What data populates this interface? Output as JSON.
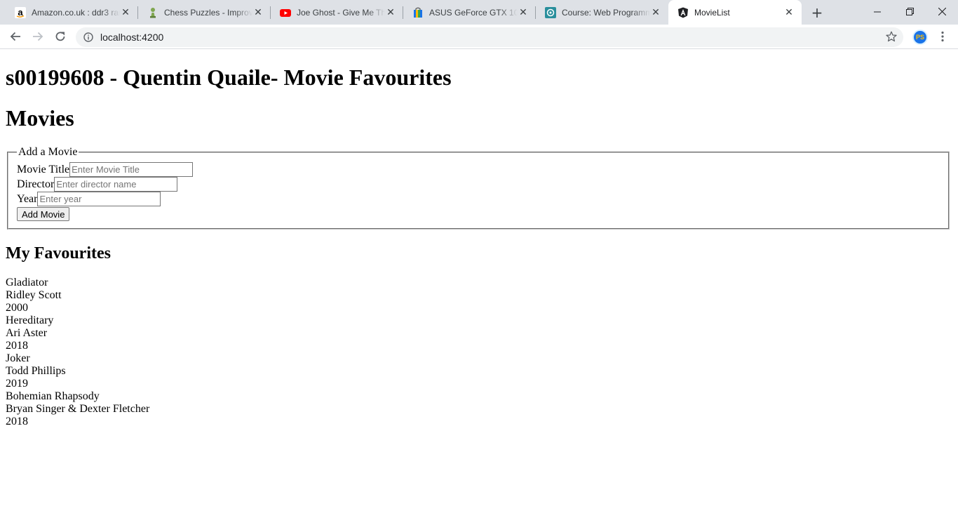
{
  "browser": {
    "tabs": [
      {
        "title": "Amazon.co.uk : ddr3 ram",
        "icon": "amazon-icon",
        "color": "#000000"
      },
      {
        "title": "Chess Puzzles - Improve",
        "icon": "chess-pawn-icon",
        "color": "#7fa650"
      },
      {
        "title": "Joe Ghost - Give Me That",
        "icon": "youtube-icon",
        "color": "#ff0000"
      },
      {
        "title": "ASUS GeForce GTX 1050",
        "icon": "shopping-bag-icon",
        "color": "#1a73e8"
      },
      {
        "title": "Course: Web Programming",
        "icon": "moodle-icon",
        "color": "#2a8f9c"
      },
      {
        "title": "MovieList",
        "icon": "angular-icon",
        "color": "#202124",
        "active": true
      }
    ],
    "url": "localhost:4200",
    "profile_initials": "PS"
  },
  "page": {
    "heading": "s00199608 - Quentin Quaile- Movie Favourites",
    "section_title": "Movies",
    "form": {
      "legend": "Add a Movie",
      "title_label": "Movie Title",
      "title_placeholder": "Enter Movie Title",
      "director_label": "Director",
      "director_placeholder": "Enter director name",
      "year_label": "Year",
      "year_placeholder": "Enter year",
      "button_label": "Add Movie"
    },
    "favourites_title": "My Favourites",
    "movies": [
      {
        "title": "Gladiator",
        "director": "Ridley Scott",
        "year": "2000"
      },
      {
        "title": "Hereditary",
        "director": "Ari Aster",
        "year": "2018"
      },
      {
        "title": "Joker",
        "director": "Todd Phillips",
        "year": "2019"
      },
      {
        "title": "Bohemian Rhapsody",
        "director": "Bryan Singer & Dexter Fletcher",
        "year": "2018"
      }
    ]
  }
}
